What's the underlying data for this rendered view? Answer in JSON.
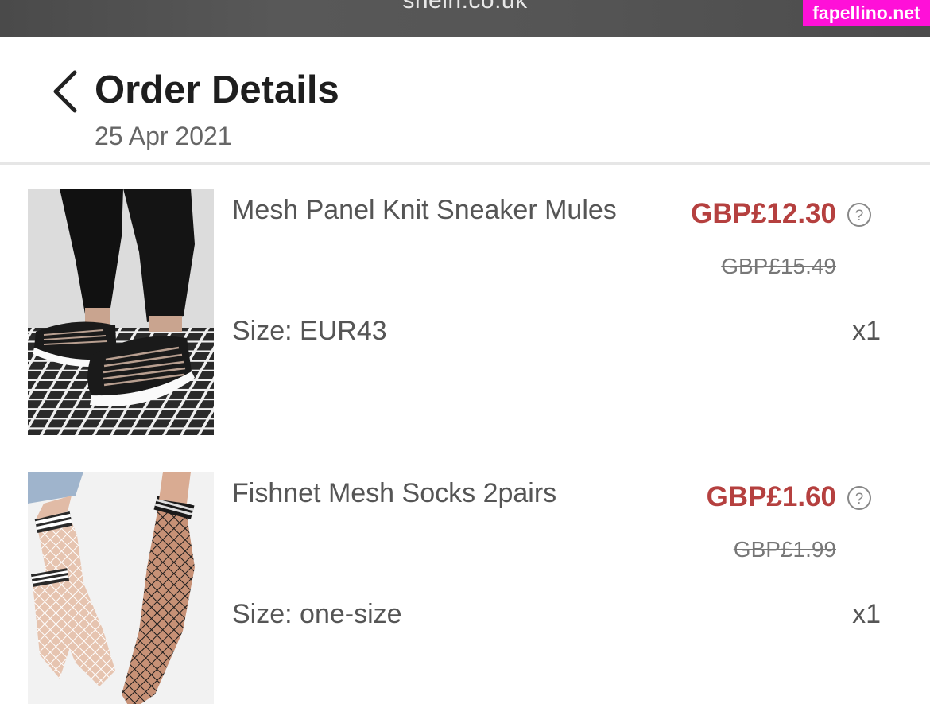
{
  "browser": {
    "url": "shein.co.uk"
  },
  "watermark": {
    "text": "fapellino.net"
  },
  "header": {
    "title": "Order Details",
    "date": "25 Apr 2021"
  },
  "items": [
    {
      "name": "Mesh Panel Knit Sneaker Mules",
      "price": "GBP£12.30",
      "original_price": "GBP£15.49",
      "size": "Size: EUR43",
      "quantity": "x1"
    },
    {
      "name": "Fishnet Mesh Socks 2pairs",
      "price": "GBP£1.60",
      "original_price": "GBP£1.99",
      "size": "Size: one-size",
      "quantity": "x1"
    }
  ],
  "colors": {
    "price": "#b5403f",
    "watermark_bg": "#ff10d8"
  },
  "icons": [
    "chevron-left-icon",
    "question-circle-icon"
  ]
}
